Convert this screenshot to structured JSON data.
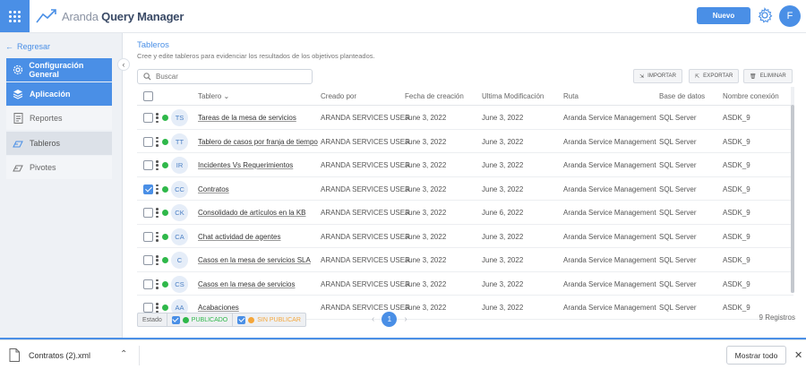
{
  "header": {
    "brand_prefix": "Aranda",
    "brand_name": "Query Manager",
    "new_button": "Nuevo",
    "avatar_initial": "F"
  },
  "sidebar": {
    "back_label": "Regresar",
    "items": [
      {
        "label": "Configuración General",
        "style": "primary",
        "icon": "gear-icon"
      },
      {
        "label": "Aplicación",
        "style": "primary",
        "icon": "layers-icon"
      },
      {
        "label": "Reportes",
        "style": "light",
        "icon": "report-icon"
      },
      {
        "label": "Tableros",
        "style": "active",
        "icon": "dashboard-icon"
      },
      {
        "label": "Pivotes",
        "style": "light",
        "icon": "pivot-icon"
      }
    ]
  },
  "main": {
    "title": "Tableros",
    "subtitle": "Cree y edite tableros para evidenciar los resultados de los objetivos planteados.",
    "search_placeholder": "Buscar",
    "actions": {
      "import": "IMPORTAR",
      "export": "EXPORTAR",
      "delete": "ELIMINAR"
    },
    "columns": [
      "Tablero",
      "Creado por",
      "Fecha de creación",
      "Ultima Modificación",
      "Ruta",
      "Base de datos",
      "Nombre conexión"
    ],
    "rows": [
      {
        "initials": "TS",
        "name": "Tareas de la mesa de servicios",
        "created_by": "ARANDA SERVICES USER",
        "created": "June 3, 2022",
        "modified": "June 3, 2022",
        "route": "Aranda Service Management",
        "db": "SQL Server",
        "connection": "ASDK_9",
        "checked": false
      },
      {
        "initials": "TT",
        "name": "Tablero de casos por franja de tiempo",
        "created_by": "ARANDA SERVICES USER",
        "created": "June 3, 2022",
        "modified": "June 3, 2022",
        "route": "Aranda Service Management",
        "db": "SQL Server",
        "connection": "ASDK_9",
        "checked": false
      },
      {
        "initials": "IR",
        "name": "Incidentes Vs Requerimientos",
        "created_by": "ARANDA SERVICES USER",
        "created": "June 3, 2022",
        "modified": "June 3, 2022",
        "route": "Aranda Service Management",
        "db": "SQL Server",
        "connection": "ASDK_9",
        "checked": false
      },
      {
        "initials": "CC",
        "name": "Contratos",
        "created_by": "ARANDA SERVICES USER",
        "created": "June 3, 2022",
        "modified": "June 3, 2022",
        "route": "Aranda Service Management",
        "db": "SQL Server",
        "connection": "ASDK_9",
        "checked": true
      },
      {
        "initials": "CK",
        "name": "Consolidado de artículos en la KB",
        "created_by": "ARANDA SERVICES USER",
        "created": "June 3, 2022",
        "modified": "June 6, 2022",
        "route": "Aranda Service Management",
        "db": "SQL Server",
        "connection": "ASDK_9",
        "checked": false
      },
      {
        "initials": "CA",
        "name": "Chat actividad de agentes",
        "created_by": "ARANDA SERVICES USER",
        "created": "June 3, 2022",
        "modified": "June 3, 2022",
        "route": "Aranda Service Management",
        "db": "SQL Server",
        "connection": "ASDK_9",
        "checked": false
      },
      {
        "initials": "C",
        "name": "Casos en la mesa de servicios SLA",
        "created_by": "ARANDA SERVICES USER",
        "created": "June 3, 2022",
        "modified": "June 3, 2022",
        "route": "Aranda Service Management",
        "db": "SQL Server",
        "connection": "ASDK_9",
        "checked": false
      },
      {
        "initials": "CS",
        "name": "Casos en la mesa de servicios",
        "created_by": "ARANDA SERVICES USER",
        "created": "June 3, 2022",
        "modified": "June 3, 2022",
        "route": "Aranda Service Management",
        "db": "SQL Server",
        "connection": "ASDK_9",
        "checked": false
      },
      {
        "initials": "AA",
        "name": "Acabaciones",
        "created_by": "ARANDA SERVICES USER",
        "created": "June 3, 2022",
        "modified": "June 3, 2022",
        "route": "Aranda Service Management",
        "db": "SQL Server",
        "connection": "ASDK_9",
        "checked": false
      }
    ],
    "status_filter": {
      "label": "Estado",
      "published": "PUBLICADO",
      "unpublished": "SIN PUBLICAR"
    },
    "pagination": {
      "current_page": "1"
    },
    "record_count": "9 Registros"
  },
  "download_bar": {
    "file_name": "Contratos (2).xml",
    "show_all": "Mostrar todo"
  },
  "colors": {
    "accent": "#4a8fe6",
    "published": "#2fb84a",
    "unpublished": "#f4a63a"
  }
}
